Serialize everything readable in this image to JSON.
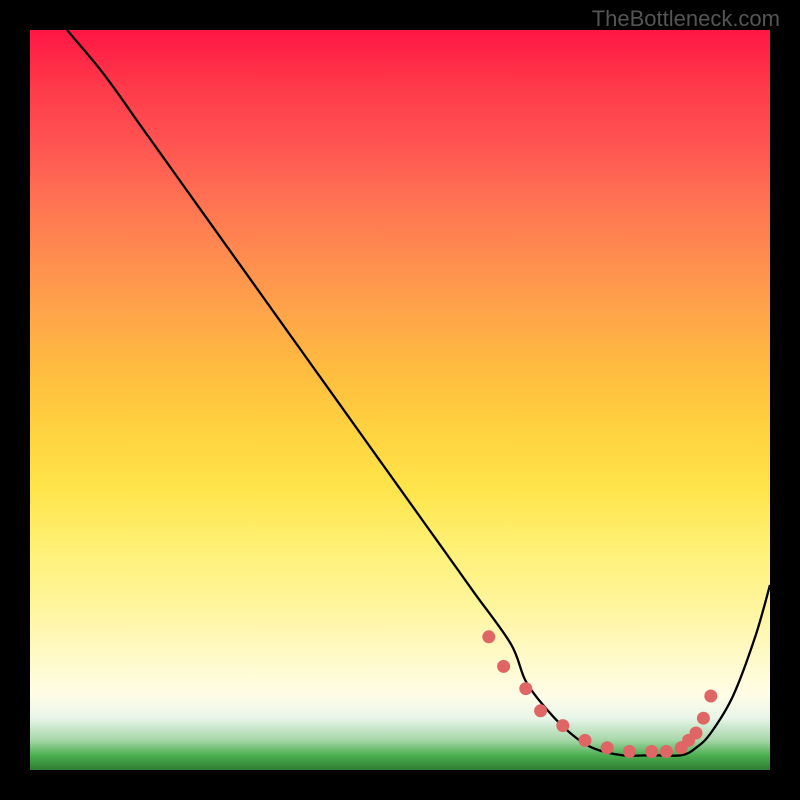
{
  "watermark": "TheBottleneck.com",
  "chart_data": {
    "type": "line",
    "title": "",
    "xlabel": "",
    "ylabel": "",
    "xlim": [
      0,
      100
    ],
    "ylim": [
      0,
      100
    ],
    "series": [
      {
        "name": "bottleneck-curve",
        "x": [
          5,
          10,
          15,
          20,
          25,
          30,
          35,
          40,
          45,
          50,
          55,
          60,
          65,
          67,
          70,
          73,
          76,
          80,
          84,
          88,
          90,
          92,
          95,
          98,
          100
        ],
        "values": [
          100,
          94,
          87,
          80,
          73,
          66,
          59,
          52,
          45,
          38,
          31,
          24,
          17,
          12,
          8,
          5,
          3,
          2,
          2,
          2,
          3,
          5,
          10,
          18,
          25
        ]
      }
    ],
    "markers": {
      "name": "highlight-dots",
      "x": [
        62,
        64,
        67,
        69,
        72,
        75,
        78,
        81,
        84,
        86,
        88,
        89,
        90,
        91,
        92
      ],
      "values": [
        18,
        14,
        11,
        8,
        6,
        4,
        3,
        2.5,
        2.5,
        2.5,
        3,
        4,
        5,
        7,
        10
      ]
    }
  }
}
